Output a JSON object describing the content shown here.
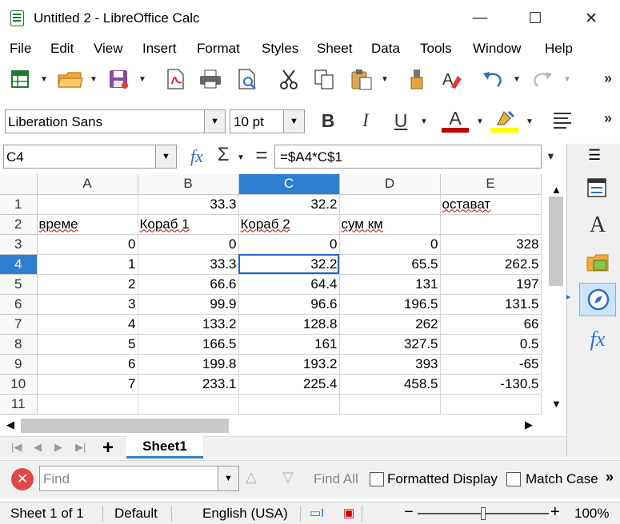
{
  "window": {
    "title": "Untitled 2 - LibreOffice Calc",
    "minimize": "—",
    "maximize": "☐",
    "close": "✕"
  },
  "menu": [
    "File",
    "Edit",
    "View",
    "Insert",
    "Format",
    "Styles",
    "Sheet",
    "Data",
    "Tools",
    "Window",
    "Help"
  ],
  "format": {
    "font_name": "Liberation Sans",
    "font_size": "10 pt",
    "bold": "B",
    "italic": "I",
    "underline": "U",
    "font_color": "A"
  },
  "formula": {
    "cell_ref": "C4",
    "fx": "fx",
    "sum": "Σ",
    "equals": "=",
    "content": "=$A4*C$1"
  },
  "columns": [
    "A",
    "B",
    "C",
    "D",
    "E"
  ],
  "rows": [
    {
      "n": "1",
      "cells": [
        "",
        "33.3",
        "32.2",
        "",
        "остават"
      ]
    },
    {
      "n": "2",
      "cells": [
        "време",
        "Кораб 1",
        "Кораб 2",
        "сум км",
        ""
      ]
    },
    {
      "n": "3",
      "cells": [
        "0",
        "0",
        "0",
        "0",
        "328"
      ]
    },
    {
      "n": "4",
      "cells": [
        "1",
        "33.3",
        "32.2",
        "65.5",
        "262.5"
      ]
    },
    {
      "n": "5",
      "cells": [
        "2",
        "66.6",
        "64.4",
        "131",
        "197"
      ]
    },
    {
      "n": "6",
      "cells": [
        "3",
        "99.9",
        "96.6",
        "196.5",
        "131.5"
      ]
    },
    {
      "n": "7",
      "cells": [
        "4",
        "133.2",
        "128.8",
        "262",
        "66"
      ]
    },
    {
      "n": "8",
      "cells": [
        "5",
        "166.5",
        "161",
        "327.5",
        "0.5"
      ]
    },
    {
      "n": "9",
      "cells": [
        "6",
        "199.8",
        "193.2",
        "393",
        "-65"
      ]
    },
    {
      "n": "10",
      "cells": [
        "7",
        "233.1",
        "225.4",
        "458.5",
        "-130.5"
      ]
    },
    {
      "n": "11",
      "cells": [
        "",
        "",
        "",
        "",
        ""
      ]
    }
  ],
  "selection": {
    "column": "C",
    "row": "4"
  },
  "sheet_tab": "Sheet1",
  "add_sheet": "+",
  "find": {
    "placeholder": "Find",
    "find_all": "Find All",
    "formatted_display": "Formatted Display",
    "match_case": "Match Case"
  },
  "status": {
    "sheet": "Sheet 1 of 1",
    "page_style": "Default",
    "language": "English (USA)",
    "zoom": "100%",
    "zoom_minus": "−",
    "zoom_plus": "+"
  },
  "colors": {
    "accent": "#2d7fd1",
    "font_color_bar": "#c00000",
    "highlight_bar": "#ffff00",
    "close_red": "#e04848"
  }
}
